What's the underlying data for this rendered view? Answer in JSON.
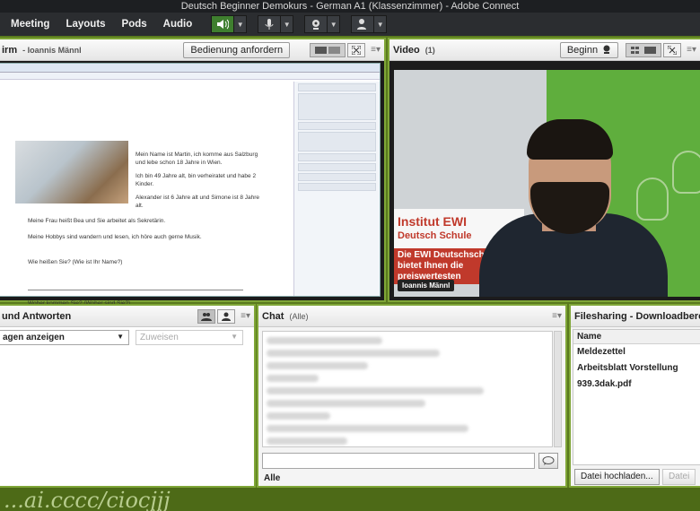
{
  "window": {
    "title": "Deutsch Beginner Demokurs - German A1 (Klassenzimmer) - Adobe Connect"
  },
  "menubar": {
    "items": [
      "Meeting",
      "Layouts",
      "Pods",
      "Audio"
    ]
  },
  "share_pod": {
    "title": "irm",
    "presenter": "- Ioannis Männl",
    "request_button": "Bedienung anfordern",
    "document": {
      "p1": "Mein Name ist Martin, ich komme aus Salzburg und lebe schon 18 Jahre in Wien.",
      "p2": "Ich bin 49 Jahre alt, bin verheiratet und habe 2 Kinder.",
      "p3": "Alexander ist 6 Jahre alt und Simone ist 8 Jahre alt.",
      "p4": "Meine Frau heißt Bea und Sie arbeitet als Sekretärin.",
      "p5": "Meine Hobbys sind wandern und lesen, ich höre auch gerne Musik.",
      "q1": "Wie heißen Sie? (Wie ist Ihr Name?)",
      "q2": "Woher kommen Sie? (Woher sind Sie?)"
    }
  },
  "video_pod": {
    "title": "Video",
    "count": "(1)",
    "start_button": "Beginn",
    "banner_title": "Institut EWI",
    "banner_sub": "Deutsch Schule",
    "banner_text": "Die EWI Deutschschule bietet Ihnen die preiswertesten",
    "name_tag": "Ioannis Männl"
  },
  "qa_pod": {
    "title": "und Antworten",
    "filter_value": "agen anzeigen",
    "assign_placeholder": "Zuweisen"
  },
  "chat_pod": {
    "title": "Chat",
    "scope": "(Alle)",
    "tab_label": "Alle"
  },
  "files_pod": {
    "title": "Filesharing - Downloadbereich",
    "column_name": "Name",
    "files": [
      "Meldezettel",
      "Arbeitsblatt Vorstellung",
      "939.3dak.pdf"
    ],
    "upload_button": "Datei hochladen...",
    "save_button": "Datei"
  },
  "footer": {
    "watermark": "...ai.cccc/ciocjjj"
  },
  "colors": {
    "pod_border": "#7fa637",
    "background": "#5a7a1e",
    "audio_active": "#3f7f2f"
  }
}
